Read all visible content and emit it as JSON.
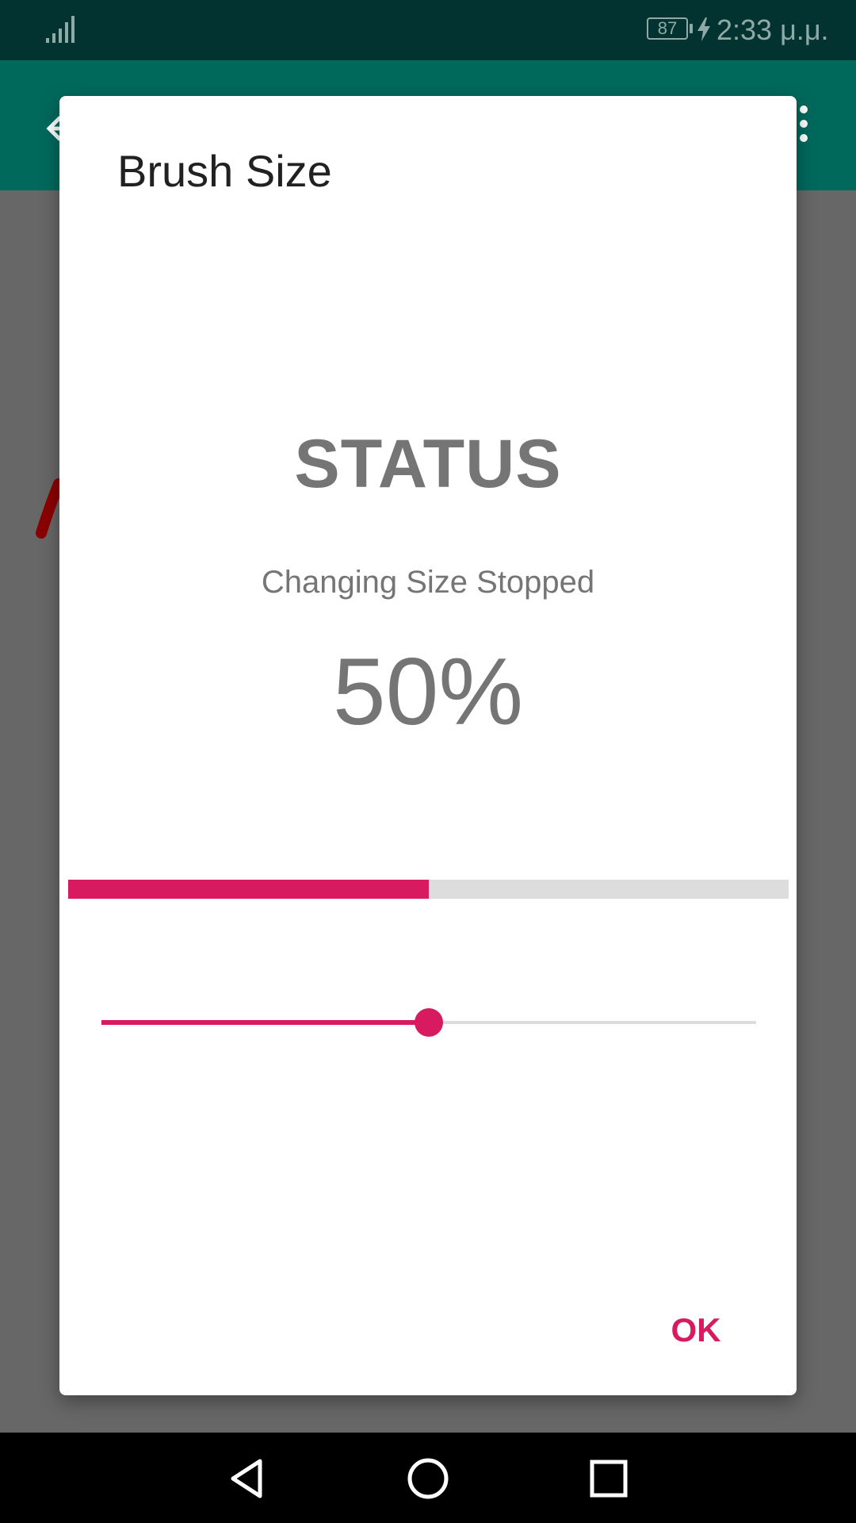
{
  "status_bar": {
    "battery_level": "87",
    "time": "2:33 μ.μ.",
    "icons": [
      "signal-icon",
      "battery-icon",
      "charging-bolt-icon"
    ]
  },
  "app_toolbar": {
    "icons": [
      "back-arrow-icon",
      "overflow-menu-icon"
    ],
    "color": "#00695c"
  },
  "dialog": {
    "title": "Brush Size",
    "status_heading": "STATUS",
    "status_message": "Changing Size Stopped",
    "percent_label": "50%",
    "progress_fraction": 0.5,
    "slider_fraction": 0.5,
    "ok_label": "OK",
    "accent_color": "#d81b60"
  },
  "nav_bar": {
    "icons": [
      "back-triangle-icon",
      "home-circle-icon",
      "recents-square-icon"
    ]
  }
}
